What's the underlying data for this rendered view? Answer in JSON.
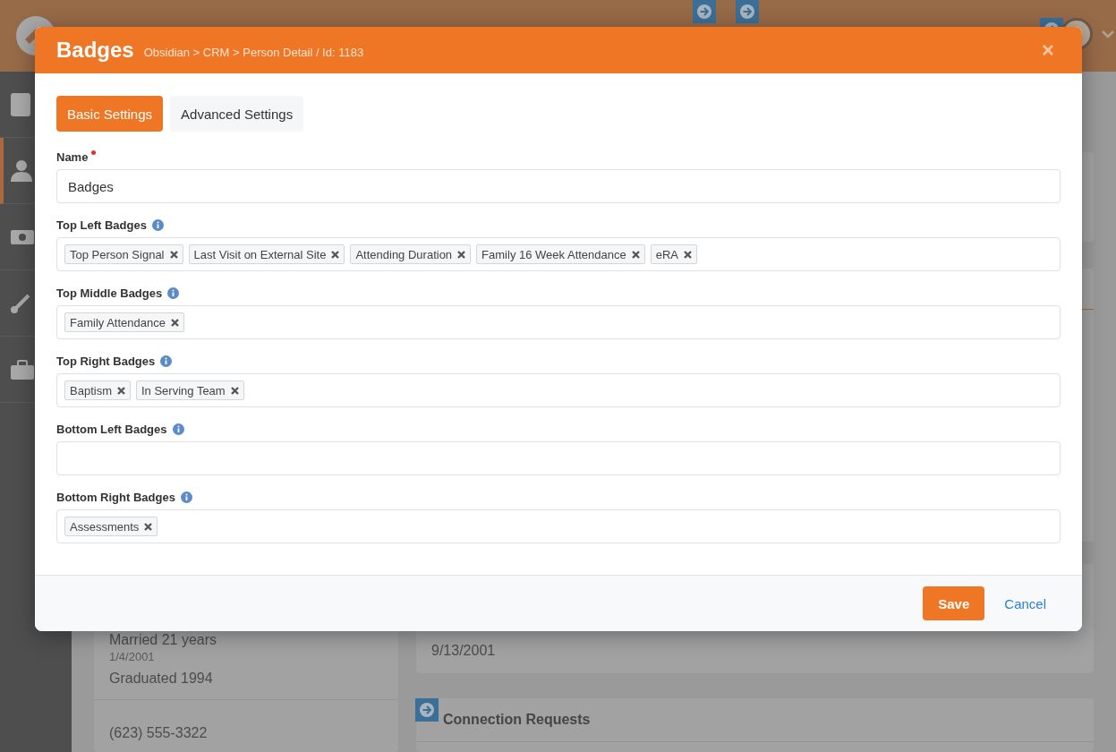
{
  "background": {
    "left_card": [
      {
        "kind": "main",
        "text": "Married 21 years"
      },
      {
        "kind": "sub",
        "text": "1/4/2001"
      },
      {
        "kind": "main",
        "text": "Graduated 1994"
      },
      {
        "kind": "divider-main",
        "text": "(623) 555-3322"
      }
    ],
    "baptism_card": {
      "value": "9/13/2001"
    },
    "connection_card": {
      "title": "Connection Requests"
    }
  },
  "modal": {
    "title": "Badges",
    "breadcrumb": "Obsidian > CRM > Person Detail / Id: 1183",
    "tabs": [
      {
        "label": "Basic Settings",
        "selected": true
      },
      {
        "label": "Advanced Settings",
        "selected": false
      }
    ],
    "fields": [
      {
        "label": "Name",
        "required": true,
        "info": false,
        "kind": "text",
        "value": "Badges"
      },
      {
        "label": "Top Left Badges",
        "required": false,
        "info": true,
        "kind": "tags",
        "tags": [
          "Top Person Signal",
          "Last Visit on External Site",
          "Attending Duration",
          "Family 16 Week Attendance",
          "eRA"
        ]
      },
      {
        "label": "Top Middle Badges",
        "required": false,
        "info": true,
        "kind": "tags",
        "tags": [
          "Family Attendance"
        ]
      },
      {
        "label": "Top Right Badges",
        "required": false,
        "info": true,
        "kind": "tags",
        "tags": [
          "Baptism",
          "In Serving Team"
        ]
      },
      {
        "label": "Bottom Left Badges",
        "required": false,
        "info": true,
        "kind": "tags"
      },
      {
        "label": "Bottom Right Badges",
        "required": false,
        "info": true,
        "kind": "tags",
        "tags": [
          "Assessments"
        ]
      }
    ],
    "buttons": [
      {
        "label": "Save",
        "kind": "primary"
      },
      {
        "label": "Cancel",
        "kind": "link"
      }
    ]
  }
}
